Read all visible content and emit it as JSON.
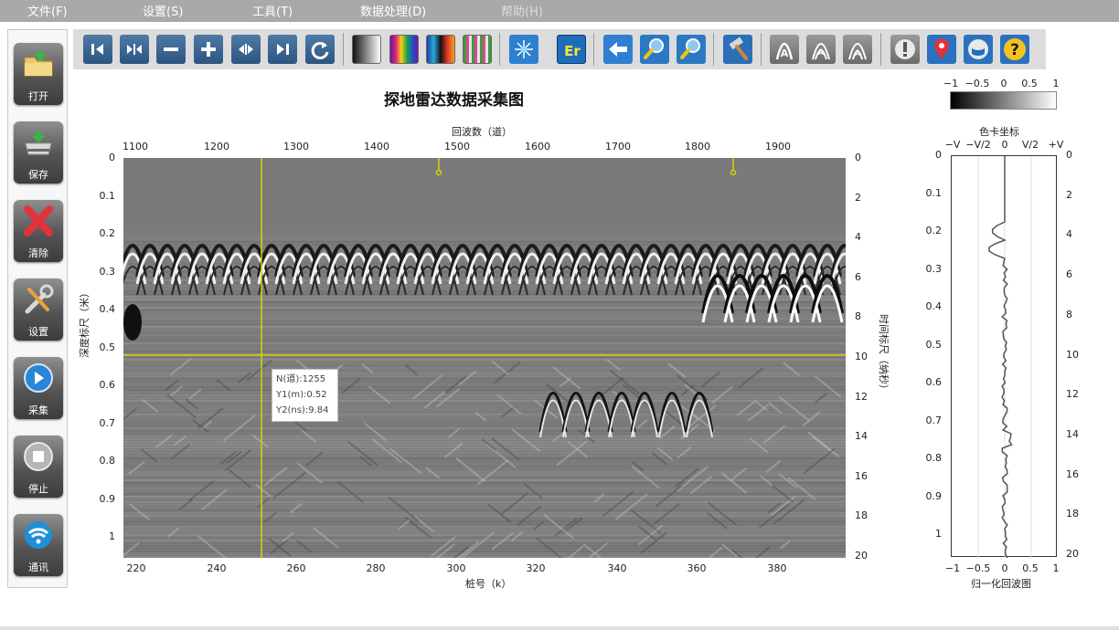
{
  "menu": {
    "file": "文件(F)",
    "settings": "设置(S)",
    "tools": "工具(T)",
    "data": "数据处理(D)",
    "help": "帮助(H)"
  },
  "sidebar": {
    "items": [
      {
        "label": "打开",
        "icon": "folder-icon"
      },
      {
        "label": "保存",
        "icon": "save-disk-icon"
      },
      {
        "label": "清除",
        "icon": "clear-x-icon"
      },
      {
        "label": "设置",
        "icon": "tools-icon"
      },
      {
        "label": "采集",
        "icon": "play-icon"
      },
      {
        "label": "停止",
        "icon": "stop-icon"
      },
      {
        "label": "通讯",
        "icon": "wifi-icon"
      }
    ]
  },
  "toolbar": {
    "icons": [
      "step-left-icon",
      "compress-icon",
      "zoom-out-icon",
      "zoom-in-icon",
      "expand-icon",
      "step-right-icon",
      "refresh-icon",
      "grayscale-palette-icon",
      "rainbow-palette-icon",
      "color-palette-icon",
      "striped-palette-icon",
      "grid-network-icon",
      "er-icon",
      "arrow-left-icon",
      "search-1-icon",
      "search-2-icon",
      "hammer-icon",
      "hyperbola-a-icon",
      "hyperbola-b-icon",
      "hyperbola-c-icon",
      "warning-icon",
      "map-pin-icon",
      "database-icon",
      "help-icon"
    ]
  },
  "chart": {
    "title": "探地雷达数据采集图",
    "top_axis_title": "回波数（道）",
    "bottom_axis_title": "桩号（k）",
    "left_axis_title": "深度标尺（米）",
    "right_axis_title": "时间标尺（纳秒）",
    "top_ticks": [
      "1100",
      "1200",
      "1300",
      "1400",
      "1500",
      "1600",
      "1700",
      "1800",
      "1900"
    ],
    "bottom_ticks": [
      "220",
      "240",
      "260",
      "280",
      "300",
      "320",
      "340",
      "360",
      "380",
      "360"
    ],
    "left_ticks": [
      "0",
      "0.1",
      "0.2",
      "0.3",
      "0.4",
      "0.5",
      "0.6",
      "0.7",
      "0.8",
      "0.9",
      "1"
    ],
    "right_ticks": [
      "0",
      "2",
      "4",
      "6",
      "8",
      "10",
      "12",
      "14",
      "16",
      "18",
      "20"
    ],
    "marker_traces": [
      1480,
      1845
    ],
    "cursor": {
      "trace": 1255,
      "depth_m": 0.52,
      "time_ns": 9.84
    },
    "tooltip": {
      "line1": "N(道):1255",
      "line2": "Y1(m):0.52",
      "line3": "Y2(ns):9.84"
    },
    "colors": {
      "cursor": "#d6d400",
      "background": "#7c7c7c"
    }
  },
  "colorbar": {
    "ticks": [
      "−1",
      "−0.5",
      "0",
      "0.5",
      "1"
    ],
    "title": "色卡坐标"
  },
  "wave_panel": {
    "title": "归一化回波图",
    "top_ticks": [
      "−V",
      "−V/2",
      "0",
      "V/2",
      "+V"
    ],
    "bottom_ticks": [
      "−1",
      "−0.5",
      "0",
      "0.5",
      "1"
    ],
    "left_ticks": [
      "0",
      "0.1",
      "0.2",
      "0.3",
      "0.4",
      "0.5",
      "0.6",
      "0.7",
      "0.8",
      "0.9",
      "1"
    ],
    "right_ticks": [
      "0",
      "2",
      "4",
      "6",
      "8",
      "10",
      "12",
      "14",
      "16",
      "18",
      "20"
    ]
  }
}
